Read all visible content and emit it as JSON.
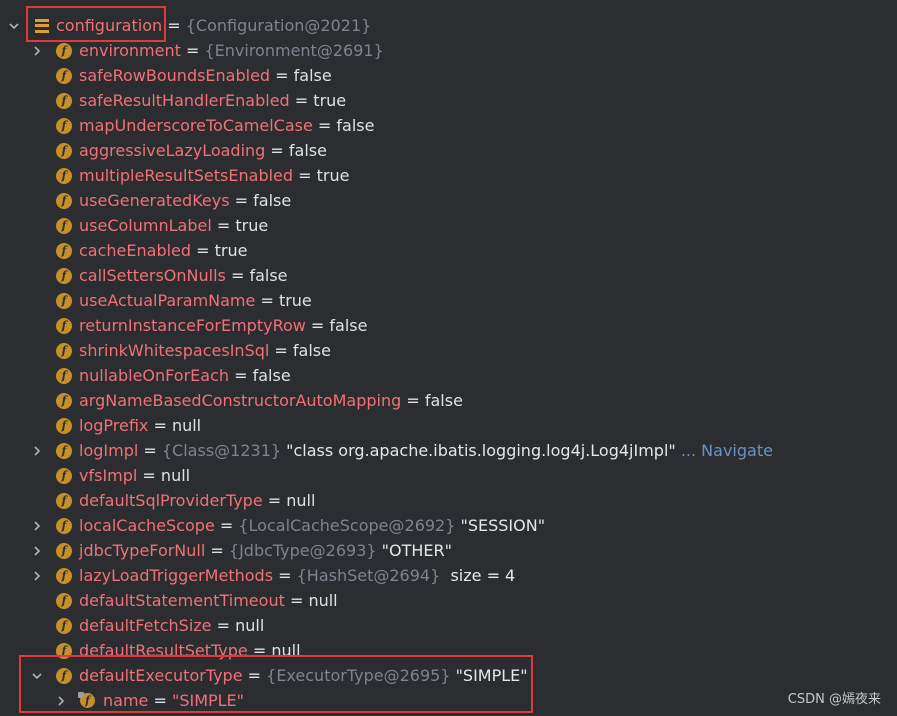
{
  "root": {
    "name": "configuration",
    "eq": " = ",
    "ref": "{Configuration@2021}"
  },
  "rows": [
    {
      "id": "environment",
      "name": "environment",
      "eq": " = ",
      "ref": "{Environment@2691}",
      "expand": true
    },
    {
      "id": "safeRowBoundsEnabled",
      "name": "safeRowBoundsEnabled",
      "eq": " = ",
      "value": "false"
    },
    {
      "id": "safeResultHandlerEnabled",
      "name": "safeResultHandlerEnabled",
      "eq": " = ",
      "value": "true"
    },
    {
      "id": "mapUnderscoreToCamelCase",
      "name": "mapUnderscoreToCamelCase",
      "eq": " = ",
      "value": "false"
    },
    {
      "id": "aggressiveLazyLoading",
      "name": "aggressiveLazyLoading",
      "eq": " = ",
      "value": "false"
    },
    {
      "id": "multipleResultSetsEnabled",
      "name": "multipleResultSetsEnabled",
      "eq": " = ",
      "value": "true"
    },
    {
      "id": "useGeneratedKeys",
      "name": "useGeneratedKeys",
      "eq": " = ",
      "value": "false"
    },
    {
      "id": "useColumnLabel",
      "name": "useColumnLabel",
      "eq": " = ",
      "value": "true"
    },
    {
      "id": "cacheEnabled",
      "name": "cacheEnabled",
      "eq": " = ",
      "value": "true"
    },
    {
      "id": "callSettersOnNulls",
      "name": "callSettersOnNulls",
      "eq": " = ",
      "value": "false"
    },
    {
      "id": "useActualParamName",
      "name": "useActualParamName",
      "eq": " = ",
      "value": "true"
    },
    {
      "id": "returnInstanceForEmptyRow",
      "name": "returnInstanceForEmptyRow",
      "eq": " = ",
      "value": "false"
    },
    {
      "id": "shrinkWhitespacesInSql",
      "name": "shrinkWhitespacesInSql",
      "eq": " = ",
      "value": "false"
    },
    {
      "id": "nullableOnForEach",
      "name": "nullableOnForEach",
      "eq": " = ",
      "value": "false"
    },
    {
      "id": "argNameBasedConstructorAutoMapping",
      "name": "argNameBasedConstructorAutoMapping",
      "eq": " = ",
      "value": "false"
    },
    {
      "id": "logPrefix",
      "name": "logPrefix",
      "eq": " = ",
      "value": "null"
    },
    {
      "id": "logImpl",
      "name": "logImpl",
      "eq": " = ",
      "ref": "{Class@1231}",
      "str": " \"class org.apache.ibatis.logging.log4j.Log4jImpl\"",
      "nav": " ... Navigate",
      "expand": true
    },
    {
      "id": "vfsImpl",
      "name": "vfsImpl",
      "eq": " = ",
      "value": "null"
    },
    {
      "id": "defaultSqlProviderType",
      "name": "defaultSqlProviderType",
      "eq": " = ",
      "value": "null"
    },
    {
      "id": "localCacheScope",
      "name": "localCacheScope",
      "eq": " = ",
      "ref": "{LocalCacheScope@2692}",
      "str": " \"SESSION\"",
      "expand": true
    },
    {
      "id": "jdbcTypeForNull",
      "name": "jdbcTypeForNull",
      "eq": " = ",
      "ref": "{JdbcType@2693}",
      "str": " \"OTHER\"",
      "expand": true
    },
    {
      "id": "lazyLoadTriggerMethods",
      "name": "lazyLoadTriggerMethods",
      "eq": " = ",
      "ref": "{HashSet@2694}",
      "str": "  size = 4",
      "expand": true
    },
    {
      "id": "defaultStatementTimeout",
      "name": "defaultStatementTimeout",
      "eq": " = ",
      "value": "null"
    },
    {
      "id": "defaultFetchSize",
      "name": "defaultFetchSize",
      "eq": " = ",
      "value": "null"
    },
    {
      "id": "defaultResultSetType",
      "name": "defaultResultSetType",
      "eq": " = ",
      "value": "null"
    },
    {
      "id": "defaultExecutorType",
      "name": "defaultExecutorType",
      "eq": " = ",
      "ref": "{ExecutorType@2695}",
      "str": " \"SIMPLE\"",
      "expand": "open"
    }
  ],
  "child": {
    "name": "name",
    "eq": " = ",
    "strv": "\"SIMPLE\""
  },
  "icons": {
    "field": "f",
    "chevron_right": "chevron-right-icon",
    "chevron_down": "chevron-down-icon",
    "config": "object-icon"
  },
  "colors": {
    "field_name": "#f07178",
    "highlight": "#e03a3e",
    "field_icon": "#c69026",
    "background": "#2b2d30"
  },
  "watermark": "CSDN @嫣夜来"
}
